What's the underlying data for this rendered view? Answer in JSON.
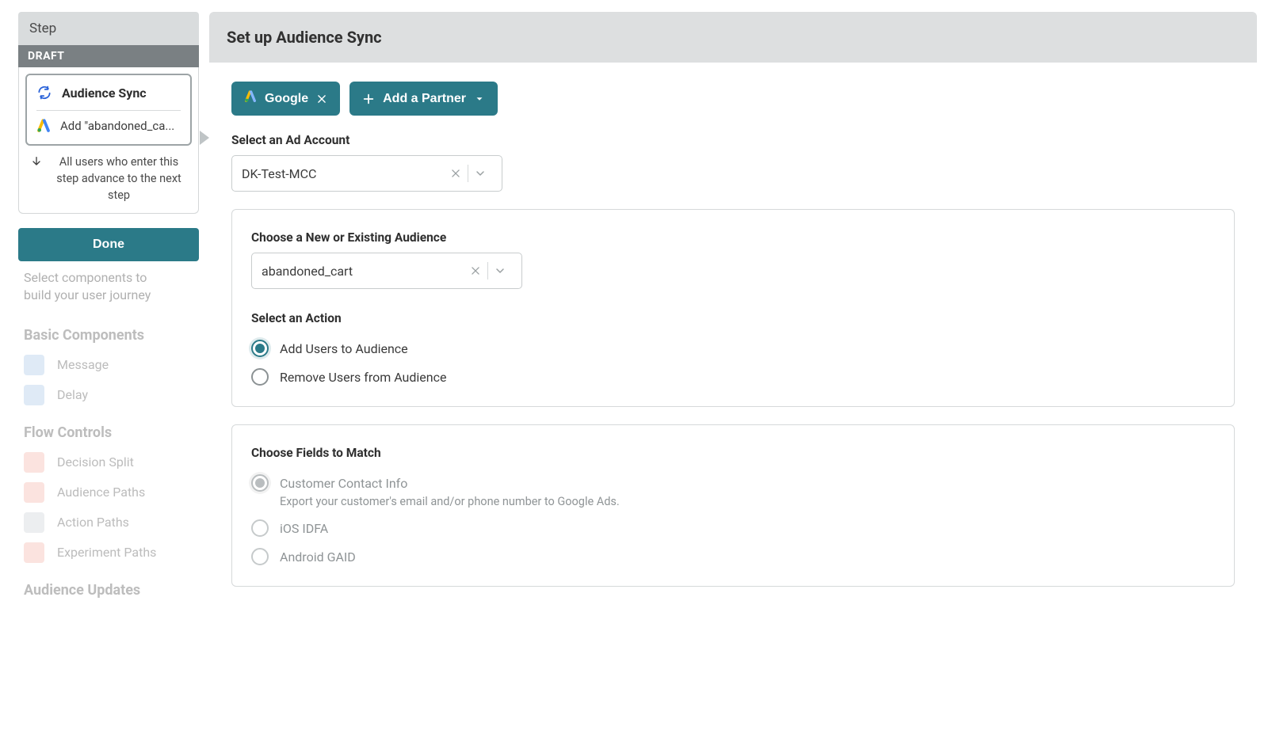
{
  "bg": {
    "hint_line1": "Select components to",
    "hint_line2": "build your user journey",
    "sections": {
      "basic": {
        "title": "Basic Components",
        "items": [
          {
            "label": "Message",
            "icon": "paper-plane",
            "color": "#dfeaf6"
          },
          {
            "label": "Delay",
            "icon": "clock",
            "color": "#dfeaf6"
          }
        ]
      },
      "flow": {
        "title": "Flow Controls",
        "items": [
          {
            "label": "Decision Split",
            "icon": "fire",
            "color": "#fbe3df"
          },
          {
            "label": "Audience Paths",
            "icon": "users",
            "color": "#fbe3df"
          },
          {
            "label": "Action Paths",
            "icon": "bolt",
            "color": "#eceef0"
          },
          {
            "label": "Experiment Paths",
            "icon": "flask",
            "color": "#fbe3df"
          }
        ]
      },
      "audience": {
        "title": "Audience Updates"
      }
    }
  },
  "step": {
    "header": "Step",
    "badge": "DRAFT",
    "title": "Audience Sync",
    "substep": "Add \"abandoned_ca...",
    "advance_text": "All users who enter this step advance to the next step",
    "done": "Done"
  },
  "main": {
    "title": "Set up Audience Sync",
    "google_label": "Google",
    "add_partner": "Add a Partner",
    "ad_account_label": "Select an Ad Account",
    "ad_account_value": "DK-Test-MCC",
    "audience_label": "Choose a New or Existing Audience",
    "audience_value": "abandoned_cart",
    "action_label": "Select an Action",
    "action_add": "Add Users to Audience",
    "action_remove": "Remove Users from Audience",
    "fields_label": "Choose Fields to Match",
    "field_contact": "Customer Contact Info",
    "field_contact_desc": "Export your customer's email and/or phone number to Google Ads.",
    "field_idfa": "iOS IDFA",
    "field_gaid": "Android GAID"
  }
}
